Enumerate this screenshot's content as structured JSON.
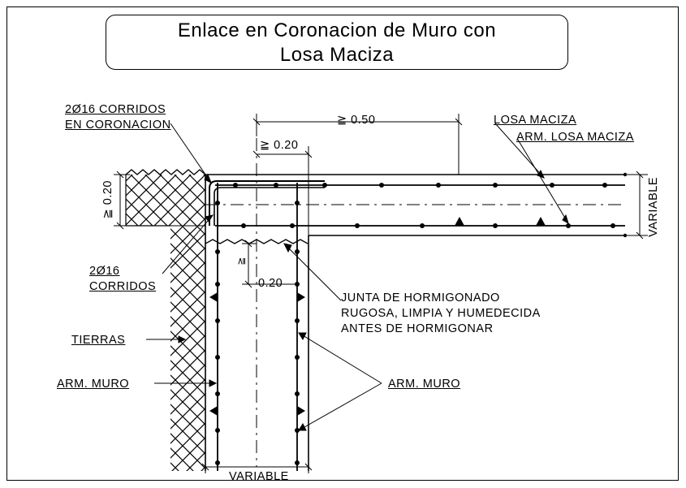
{
  "title": {
    "line1": "Enlace en Coronacion de Muro con",
    "line2": "Losa Maciza"
  },
  "labels": {
    "corridos_coronacion": "2Ø16 CORRIDOS\nEN CORONACION",
    "losa_maciza": "LOSA MACIZA",
    "arm_losa_maciza": "ARM. LOSA MACIZA",
    "variable_right": "VARIABLE",
    "corridos_2": "2Ø16\nCORRIDOS",
    "tierras": "TIERRAS",
    "arm_muro_left": "ARM. MURO",
    "arm_muro_right": "ARM. MURO",
    "junta": "JUNTA DE HORMIGONADO\nRUGOSA, LIMPIA Y HUMEDECIDA\nANTES DE HORMIGONAR",
    "variable_bottom": "VARIABLE"
  },
  "dimensions": {
    "top_050": "≧ 0.50",
    "top_020": "≧ 0.20",
    "left_020": "≧ 0.20",
    "inner_020": "0.20"
  }
}
